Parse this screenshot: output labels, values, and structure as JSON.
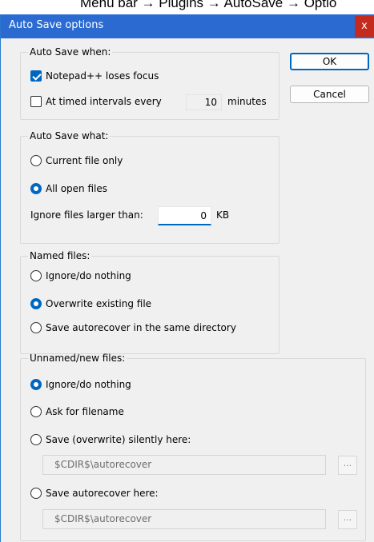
{
  "header_caption": "Menu bar → Plugins → AutoSave → Optio",
  "dialog": {
    "title": "Auto Save options",
    "close_label": "x"
  },
  "buttons": {
    "ok": "OK",
    "cancel": "Cancel"
  },
  "when_group": {
    "legend": "Auto Save when:",
    "loses_focus": {
      "label": "Notepad++ loses focus",
      "checked": true
    },
    "timed": {
      "label": "At timed intervals every",
      "checked": false,
      "value": "10",
      "unit": "minutes"
    }
  },
  "what_group": {
    "legend": "Auto Save what:",
    "options": [
      {
        "label": "Current file only",
        "selected": false
      },
      {
        "label": "All open files",
        "selected": true
      }
    ],
    "ignore_label": "Ignore files larger than:",
    "ignore_value": "0",
    "ignore_unit": "KB"
  },
  "named_group": {
    "legend": "Named files:",
    "options": [
      {
        "label": "Ignore/do nothing",
        "selected": false
      },
      {
        "label": "Overwrite existing file",
        "selected": true
      },
      {
        "label": "Save autorecover in the same directory",
        "selected": false
      }
    ]
  },
  "unnamed_group": {
    "legend": "Unnamed/new files:",
    "options": [
      {
        "label": "Ignore/do nothing",
        "selected": true
      },
      {
        "label": "Ask for filename",
        "selected": false
      },
      {
        "label": "Save (overwrite) silently here:",
        "selected": false
      },
      {
        "label": "Save autorecover here:",
        "selected": false
      }
    ],
    "silent_path": "$CDIR$\\autorecover",
    "autorecover_path": "$CDIR$\\autorecover",
    "browse_label": "..."
  },
  "colors": {
    "titlebar": "#2b6bd1",
    "close": "#c42b1c",
    "accent": "#0067c0",
    "face": "#f0f0f0"
  }
}
